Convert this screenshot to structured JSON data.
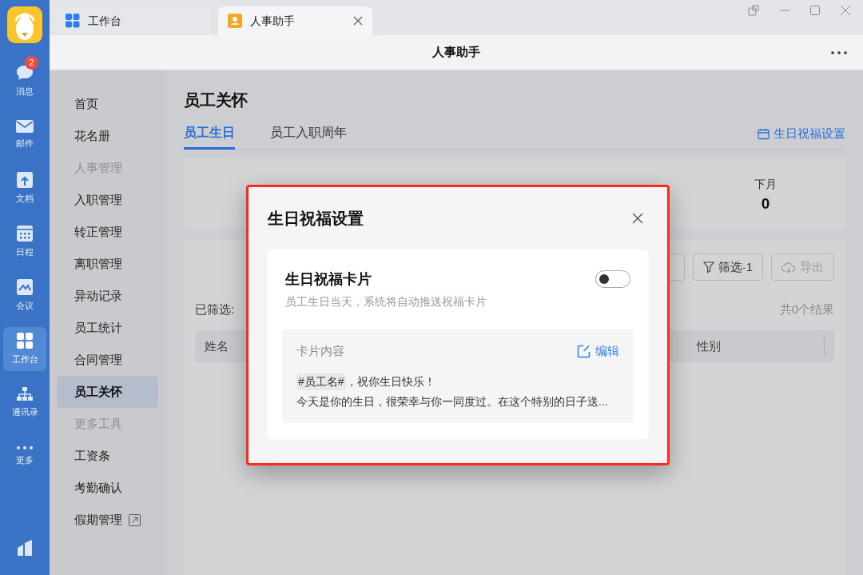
{
  "rail": {
    "items": [
      {
        "label": "消息",
        "kind": "chat",
        "badge": "2",
        "selected": false
      },
      {
        "label": "邮件",
        "kind": "mail",
        "selected": false
      },
      {
        "label": "文档",
        "kind": "doc",
        "selected": false
      },
      {
        "label": "日程",
        "kind": "calendar",
        "selected": false
      },
      {
        "label": "会议",
        "kind": "meeting",
        "selected": false
      },
      {
        "label": "工作台",
        "kind": "grid",
        "selected": true
      },
      {
        "label": "通讯录",
        "kind": "org",
        "selected": false
      },
      {
        "label": "更多",
        "kind": "dots",
        "selected": false
      }
    ]
  },
  "tabs": [
    {
      "label": "工作台",
      "kind": "grid",
      "selected": false
    },
    {
      "label": "人事助手",
      "kind": "person",
      "selected": true,
      "closable": true
    }
  ],
  "header": {
    "title": "人事助手"
  },
  "nav": [
    {
      "kind": "item",
      "label": "首页",
      "selected": false
    },
    {
      "kind": "item",
      "label": "花名册",
      "selected": false
    },
    {
      "kind": "group",
      "label": "人事管理"
    },
    {
      "kind": "item",
      "label": "入职管理",
      "selected": false
    },
    {
      "kind": "item",
      "label": "转正管理",
      "selected": false
    },
    {
      "kind": "item",
      "label": "离职管理",
      "selected": false
    },
    {
      "kind": "item",
      "label": "异动记录",
      "selected": false
    },
    {
      "kind": "item",
      "label": "员工统计",
      "selected": false
    },
    {
      "kind": "item",
      "label": "合同管理",
      "selected": false
    },
    {
      "kind": "item",
      "label": "员工关怀",
      "selected": true
    },
    {
      "kind": "group",
      "label": "更多工具"
    },
    {
      "kind": "item",
      "label": "工资条",
      "selected": false
    },
    {
      "kind": "item",
      "label": "考勤确认",
      "selected": false
    },
    {
      "kind": "item",
      "label": "假期管理",
      "selected": false,
      "external": true
    }
  ],
  "page": {
    "title": "员工关怀",
    "tabs": [
      {
        "label": "员工生日",
        "selected": true
      },
      {
        "label": "员工入职周年",
        "selected": false
      }
    ],
    "settings_link": "生日祝福设置",
    "stat": {
      "label": "下月",
      "value": "0"
    },
    "filter_button": "筛选·1",
    "export_button": {
      "label": "导出",
      "disabled": true
    },
    "filtered_label": "已筛选:",
    "result_count": "共0个结果",
    "columns": [
      "姓名",
      "性别"
    ]
  },
  "dialog": {
    "title": "生日祝福设置",
    "card": {
      "title": "生日祝福卡片",
      "on": false,
      "description": "员工生日当天，系统将自动推送祝福卡片",
      "content_label": "卡片内容",
      "edit": "编辑",
      "tag": "#员工名#",
      "line1": "，祝你生日快乐！",
      "line2": "今天是你的生日，很荣幸与你一同度过。在这个特别的日子送..."
    }
  }
}
